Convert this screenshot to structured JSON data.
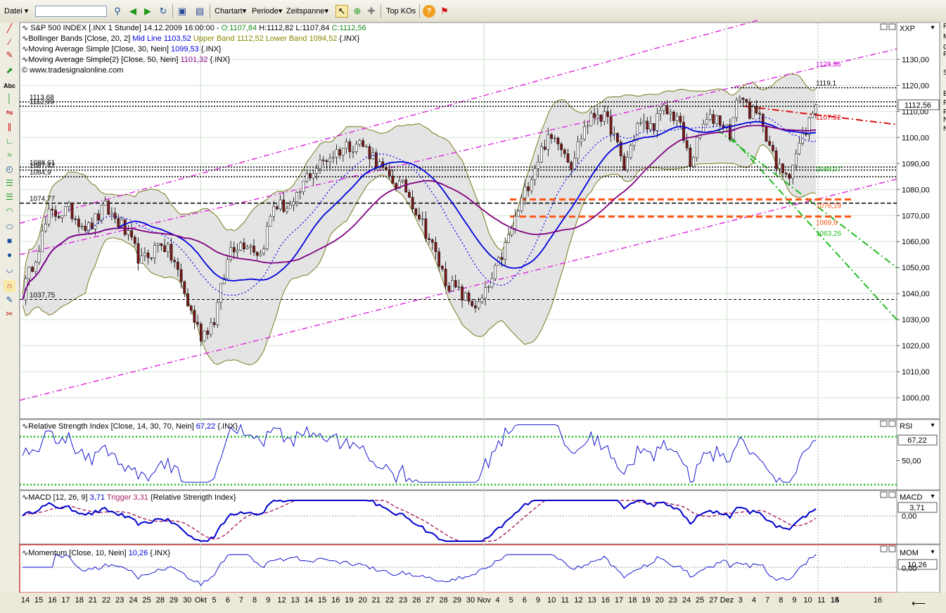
{
  "toolbar": {
    "datei": "Datei",
    "search_value": "",
    "chartart": "Chartart",
    "periode": "Periode",
    "zeitspanne": "Zeitspanne",
    "topkos": "Top KOs"
  },
  "right_edge_fragments": [
    "F",
    "M",
    "C",
    "F",
    "S",
    "E",
    "F",
    "F",
    "N",
    "N"
  ],
  "chart_data": [
    {
      "type": "line",
      "id": "price",
      "header": {
        "symbol": "S&P 500 INDEX [.INX  1 Stunde] 14.12.2009 16:00:00 - ",
        "o": "O:1107,84",
        "h": "H:1112,82",
        "l": "L:1107,84",
        "c": "C:1112,56"
      },
      "legend": [
        {
          "prefix": "Bollinger Bands [Close, 20, 2] ",
          "parts": [
            {
              "t": "Mid Line 1103,52",
              "c": "#0000dd"
            },
            {
              "t": " Upper Band 1112,52 Lower Band 1094,52",
              "c": "#888800"
            },
            {
              "t": " {.INX}",
              "c": "#000"
            }
          ]
        },
        {
          "prefix": "Moving Average Simple [Close, 30, Nein] ",
          "parts": [
            {
              "t": "1099,53",
              "c": "#0000dd"
            },
            {
              "t": " {.INX}",
              "c": "#000"
            }
          ]
        },
        {
          "prefix": "Moving Average Simple(2) [Close, 50, Nein] ",
          "parts": [
            {
              "t": "1101,32",
              "c": "#880088"
            },
            {
              "t": " {.INX}",
              "c": "#000"
            }
          ]
        }
      ],
      "copyright": "© www.tradesignalonline.com",
      "axis_label": "XXP",
      "last_price": "1112,56",
      "ylim": [
        993,
        1142
      ],
      "y_ticks": [
        "1000,00",
        "1010,00",
        "1020,00",
        "1030,00",
        "1040,00",
        "1050,00",
        "1060,00",
        "1070,00",
        "1080,00",
        "1090,00",
        "1100,00",
        "1110,00",
        "1120,00",
        "1130,00"
      ],
      "y_tick_values": [
        1000,
        1010,
        1020,
        1030,
        1040,
        1050,
        1060,
        1070,
        1080,
        1090,
        1100,
        1110,
        1120,
        1130
      ],
      "bar_count": 240,
      "close_keypoints": [
        [
          0,
          1040
        ],
        [
          8,
          1070
        ],
        [
          14,
          1072
        ],
        [
          20,
          1065
        ],
        [
          25,
          1073
        ],
        [
          30,
          1066
        ],
        [
          36,
          1052
        ],
        [
          42,
          1060
        ],
        [
          46,
          1052
        ],
        [
          50,
          1036
        ],
        [
          54,
          1024
        ],
        [
          58,
          1030
        ],
        [
          63,
          1058
        ],
        [
          68,
          1060
        ],
        [
          72,
          1055
        ],
        [
          76,
          1074
        ],
        [
          82,
          1073
        ],
        [
          86,
          1085
        ],
        [
          92,
          1092
        ],
        [
          98,
          1097
        ],
        [
          102,
          1098
        ],
        [
          106,
          1093
        ],
        [
          110,
          1085
        ],
        [
          116,
          1080
        ],
        [
          120,
          1070
        ],
        [
          124,
          1058
        ],
        [
          128,
          1045
        ],
        [
          134,
          1038
        ],
        [
          138,
          1035
        ],
        [
          142,
          1045
        ],
        [
          146,
          1058
        ],
        [
          150,
          1072
        ],
        [
          154,
          1086
        ],
        [
          158,
          1098
        ],
        [
          162,
          1100
        ],
        [
          166,
          1090
        ],
        [
          170,
          1104
        ],
        [
          174,
          1110
        ],
        [
          178,
          1104
        ],
        [
          182,
          1088
        ],
        [
          186,
          1105
        ],
        [
          190,
          1104
        ],
        [
          194,
          1110
        ],
        [
          198,
          1108
        ],
        [
          202,
          1090
        ],
        [
          206,
          1105
        ],
        [
          210,
          1108
        ],
        [
          214,
          1102
        ],
        [
          217,
          1117
        ],
        [
          220,
          1110
        ],
        [
          224,
          1106
        ],
        [
          228,
          1088
        ],
        [
          232,
          1087
        ],
        [
          236,
          1100
        ],
        [
          240,
          1112.56
        ]
      ],
      "hlines": [
        {
          "y": 1113.68,
          "label": "1113,68",
          "style": "black-dotted"
        },
        {
          "y": 1111.99,
          "label": "1112,99",
          "style": "black-dotted"
        },
        {
          "y": 1119.1,
          "label": "1119,1",
          "style": "black-dotted-right"
        },
        {
          "y": 1088.61,
          "label": "1088,61",
          "style": "black-dotted"
        },
        {
          "y": 1087.47,
          "label": "1087,47",
          "style": "black-dotted"
        },
        {
          "y": 1084.9,
          "label": "1084,9",
          "style": "black-dotted"
        },
        {
          "y": 1074.77,
          "label": "1074,77",
          "style": "black-dashed"
        },
        {
          "y": 1037.75,
          "label": "1037,75",
          "style": "black-thin-dashed"
        },
        {
          "y": 1076.19,
          "label": "1076,19",
          "style": "orange-dashed"
        },
        {
          "y": 1069.6,
          "label": "1069,6",
          "style": "orange-dashed"
        }
      ],
      "level_labels": [
        {
          "text": "1128,36",
          "color": "#cc00cc",
          "y": 1128.36
        },
        {
          "text": "1107,92",
          "color": "#dd0000",
          "y": 1107.92
        },
        {
          "text": "1088,07",
          "color": "#22bb22",
          "y": 1088.07
        },
        {
          "text": "1063,26",
          "color": "#22bb22",
          "y": 1063.26
        }
      ]
    },
    {
      "type": "line",
      "id": "rsi",
      "legend": "Relative Strength Index [Close, 14, 30, 70, Nein] ",
      "value": "67,22",
      "suffix": " {.INX}",
      "axis_label": "RSI",
      "y_tick": "50,00",
      "ylim": [
        28,
        82
      ],
      "levels": [
        70,
        30
      ]
    },
    {
      "type": "line",
      "id": "macd",
      "legend": "MACD [12, 26, 9] ",
      "value": "3,71",
      "trigger": " Trigger 3,31",
      "suffix": " {Relative Strength Index}",
      "axis_label": "MACD",
      "y_tick": "0,00"
    },
    {
      "type": "line",
      "id": "momentum",
      "legend": "Momentum [Close, 10, Nein] ",
      "value": "10,26",
      "suffix": " {.INX}",
      "axis_label": "MOM",
      "y_tick": "0,00"
    }
  ],
  "x_axis": {
    "labels": [
      "14",
      "15",
      "16",
      "17",
      "18",
      "21",
      "22",
      "23",
      "24",
      "25",
      "28",
      "29",
      "30",
      "Okt",
      "5",
      "6",
      "7",
      "8",
      "9",
      "12",
      "13",
      "14",
      "15",
      "16",
      "19",
      "20",
      "21",
      "22",
      "23",
      "26",
      "27",
      "28",
      "29",
      "30",
      "Nov",
      "4",
      "5",
      "6",
      "9",
      "10",
      "11",
      "12",
      "13",
      "16",
      "17",
      "18",
      "19",
      "20",
      "23",
      "24",
      "25",
      "27",
      "Dez",
      "3",
      "4",
      "7",
      "8",
      "9",
      "10",
      "11",
      "14",
      "15",
      "16"
    ]
  }
}
